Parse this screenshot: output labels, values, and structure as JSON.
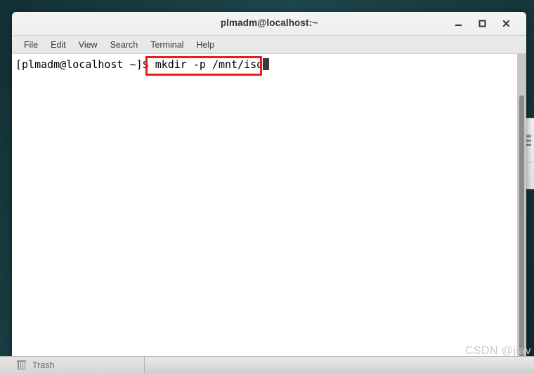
{
  "desktop": {
    "background_color": "#17383d"
  },
  "taskbar": {
    "trash": {
      "icon": "trash-icon",
      "label": "Trash"
    }
  },
  "watermark": {
    "text": "CSDN @jiav"
  },
  "terminal": {
    "title": "plmadm@localhost:~",
    "window_buttons": {
      "minimize": "minimize-icon",
      "maximize": "maximize-icon",
      "close": "close-icon"
    },
    "menu": [
      {
        "label": "File"
      },
      {
        "label": "Edit"
      },
      {
        "label": "View"
      },
      {
        "label": "Search"
      },
      {
        "label": "Terminal"
      },
      {
        "label": "Help"
      }
    ],
    "lines": [
      {
        "prompt": "[plmadm@localhost ~]$ ",
        "command": "mkdir -p /mnt/iso"
      }
    ],
    "annotation": {
      "color": "#ee1b1b",
      "target_text": "mkdir -p /mnt/iso"
    }
  }
}
